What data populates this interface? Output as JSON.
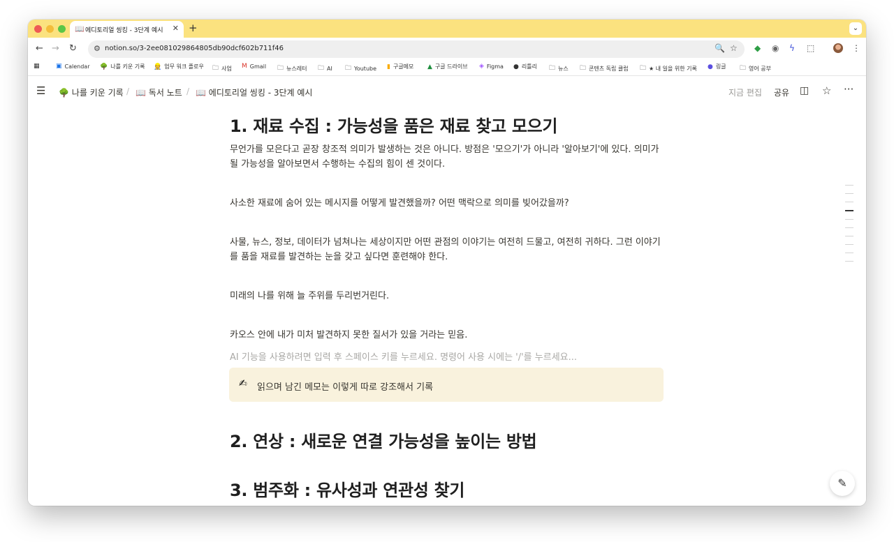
{
  "browser": {
    "tab": {
      "icon": "book-icon",
      "title": "에디토리얼 씽킹 - 3단계 예시"
    },
    "address": {
      "url": "notion.so/3-2ee081029864805db90dcf602b711f46"
    },
    "bookmarks": [
      {
        "icon": "calendar-icon",
        "label": "Calendar"
      },
      {
        "icon": "tree-icon",
        "label": "나를 키운 기록"
      },
      {
        "icon": "worker-icon",
        "label": "업무 워크 플로우"
      },
      {
        "icon": "folder-icon",
        "label": "사업"
      },
      {
        "icon": "gmail-icon",
        "label": "Gmail"
      },
      {
        "icon": "folder-icon",
        "label": "뉴스레터"
      },
      {
        "icon": "folder-icon",
        "label": "AI"
      },
      {
        "icon": "folder-icon",
        "label": "Youtube"
      },
      {
        "icon": "memo-icon",
        "label": "구글메모"
      },
      {
        "icon": "drive-icon",
        "label": "구글 드라이브"
      },
      {
        "icon": "figma-icon",
        "label": "Figma"
      },
      {
        "icon": "app-icon",
        "label": "리틀리"
      },
      {
        "icon": "folder-icon",
        "label": "뉴스"
      },
      {
        "icon": "folder-icon",
        "label": "콘텐츠 독립 클럽"
      },
      {
        "icon": "folder-icon",
        "label": "★ 내 일을 위한 기록"
      },
      {
        "icon": "app-icon",
        "label": "링글"
      },
      {
        "icon": "folder-icon",
        "label": "영어 공부"
      }
    ]
  },
  "notion": {
    "breadcrumb": [
      {
        "icon": "tree-icon",
        "label": "나를 키운 기록"
      },
      {
        "icon": "book-icon",
        "label": "독서 노트"
      },
      {
        "icon": "book-icon",
        "label": "에디토리얼 씽킹 - 3단계 예시"
      }
    ],
    "edited": "지금 편집",
    "share": "공유"
  },
  "page": {
    "heading1": "1. 재료 수집 : 가능성을 품은 재료 찾고 모으기",
    "paragraphs": [
      "무언가를 모은다고 곧장 창조적 의미가 발생하는 것은 아니다. 방점은 '모으기'가 아니라 '알아보기'에 있다. 의미가 될 가능성을 알아보면서 수행하는 수집의 힘이 센 것이다.",
      "사소한 재료에 숨어 있는 메시지를 어떻게 발견했을까? 어떤 맥락으로 의미를 빚어갔을까?",
      "사물, 뉴스, 정보, 데이터가 넘쳐나는 세상이지만 어떤 관점의 이야기는 여전히 드물고, 여전히 귀하다. 그런 이야기를 품을 재료를 발견하는 눈을 갖고 싶다면 훈련해야 한다.",
      "미래의 나를 위해 늘 주위를 두리번거린다.",
      "카오스 안에 내가 미처 발견하지 못한 질서가 있을 거라는 믿음."
    ],
    "placeholder": "AI 기능을 사용하려면 입력 후 스페이스 키를 누르세요. 명령어 사용 시에는 '/'를 누르세요...",
    "callout": {
      "icon": "writing-hand-icon",
      "text": "읽으며 남긴 메모는 이렇게 따로 강조해서 기록"
    },
    "heading2": "2. 연상 : 새로운 연결 가능성을 높이는 방법",
    "heading3": "3. 범주화 : 유사성과 연관성 찾기"
  }
}
